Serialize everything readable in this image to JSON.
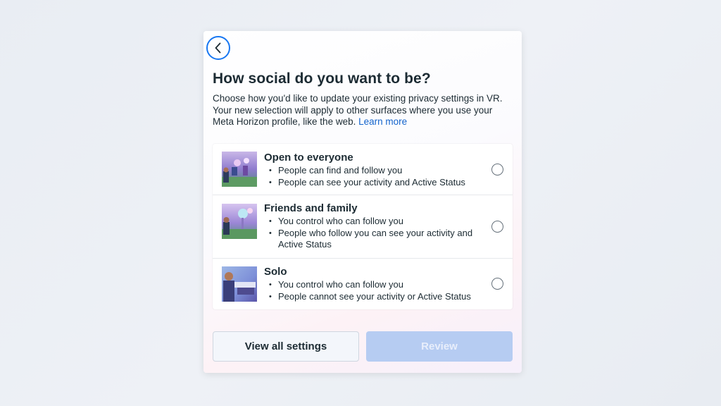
{
  "dialog": {
    "back_icon": "chevron-left-icon",
    "title": "How social do you want to be?",
    "description": "Choose how you'd like to update your existing privacy settings in VR. Your new selection will apply to other surfaces where you use your Meta Horizon profile, like the web.",
    "learn_more": "Learn more",
    "options": [
      {
        "title": "Open to everyone",
        "bullets": [
          "People can find and follow you",
          "People can see your activity and Active Status"
        ],
        "selected": false
      },
      {
        "title": "Friends and family",
        "bullets": [
          "You control who can follow you",
          "People who follow you can see your activity and Active Status"
        ],
        "selected": false
      },
      {
        "title": "Solo",
        "bullets": [
          "You control who can follow you",
          "People cannot see your activity or Active Status"
        ],
        "selected": false
      }
    ],
    "view_all_label": "View all settings",
    "review_label": "Review"
  },
  "colors": {
    "accent": "#1877f2",
    "link": "#1464cc",
    "primary_disabled": "#b6ccf2"
  }
}
